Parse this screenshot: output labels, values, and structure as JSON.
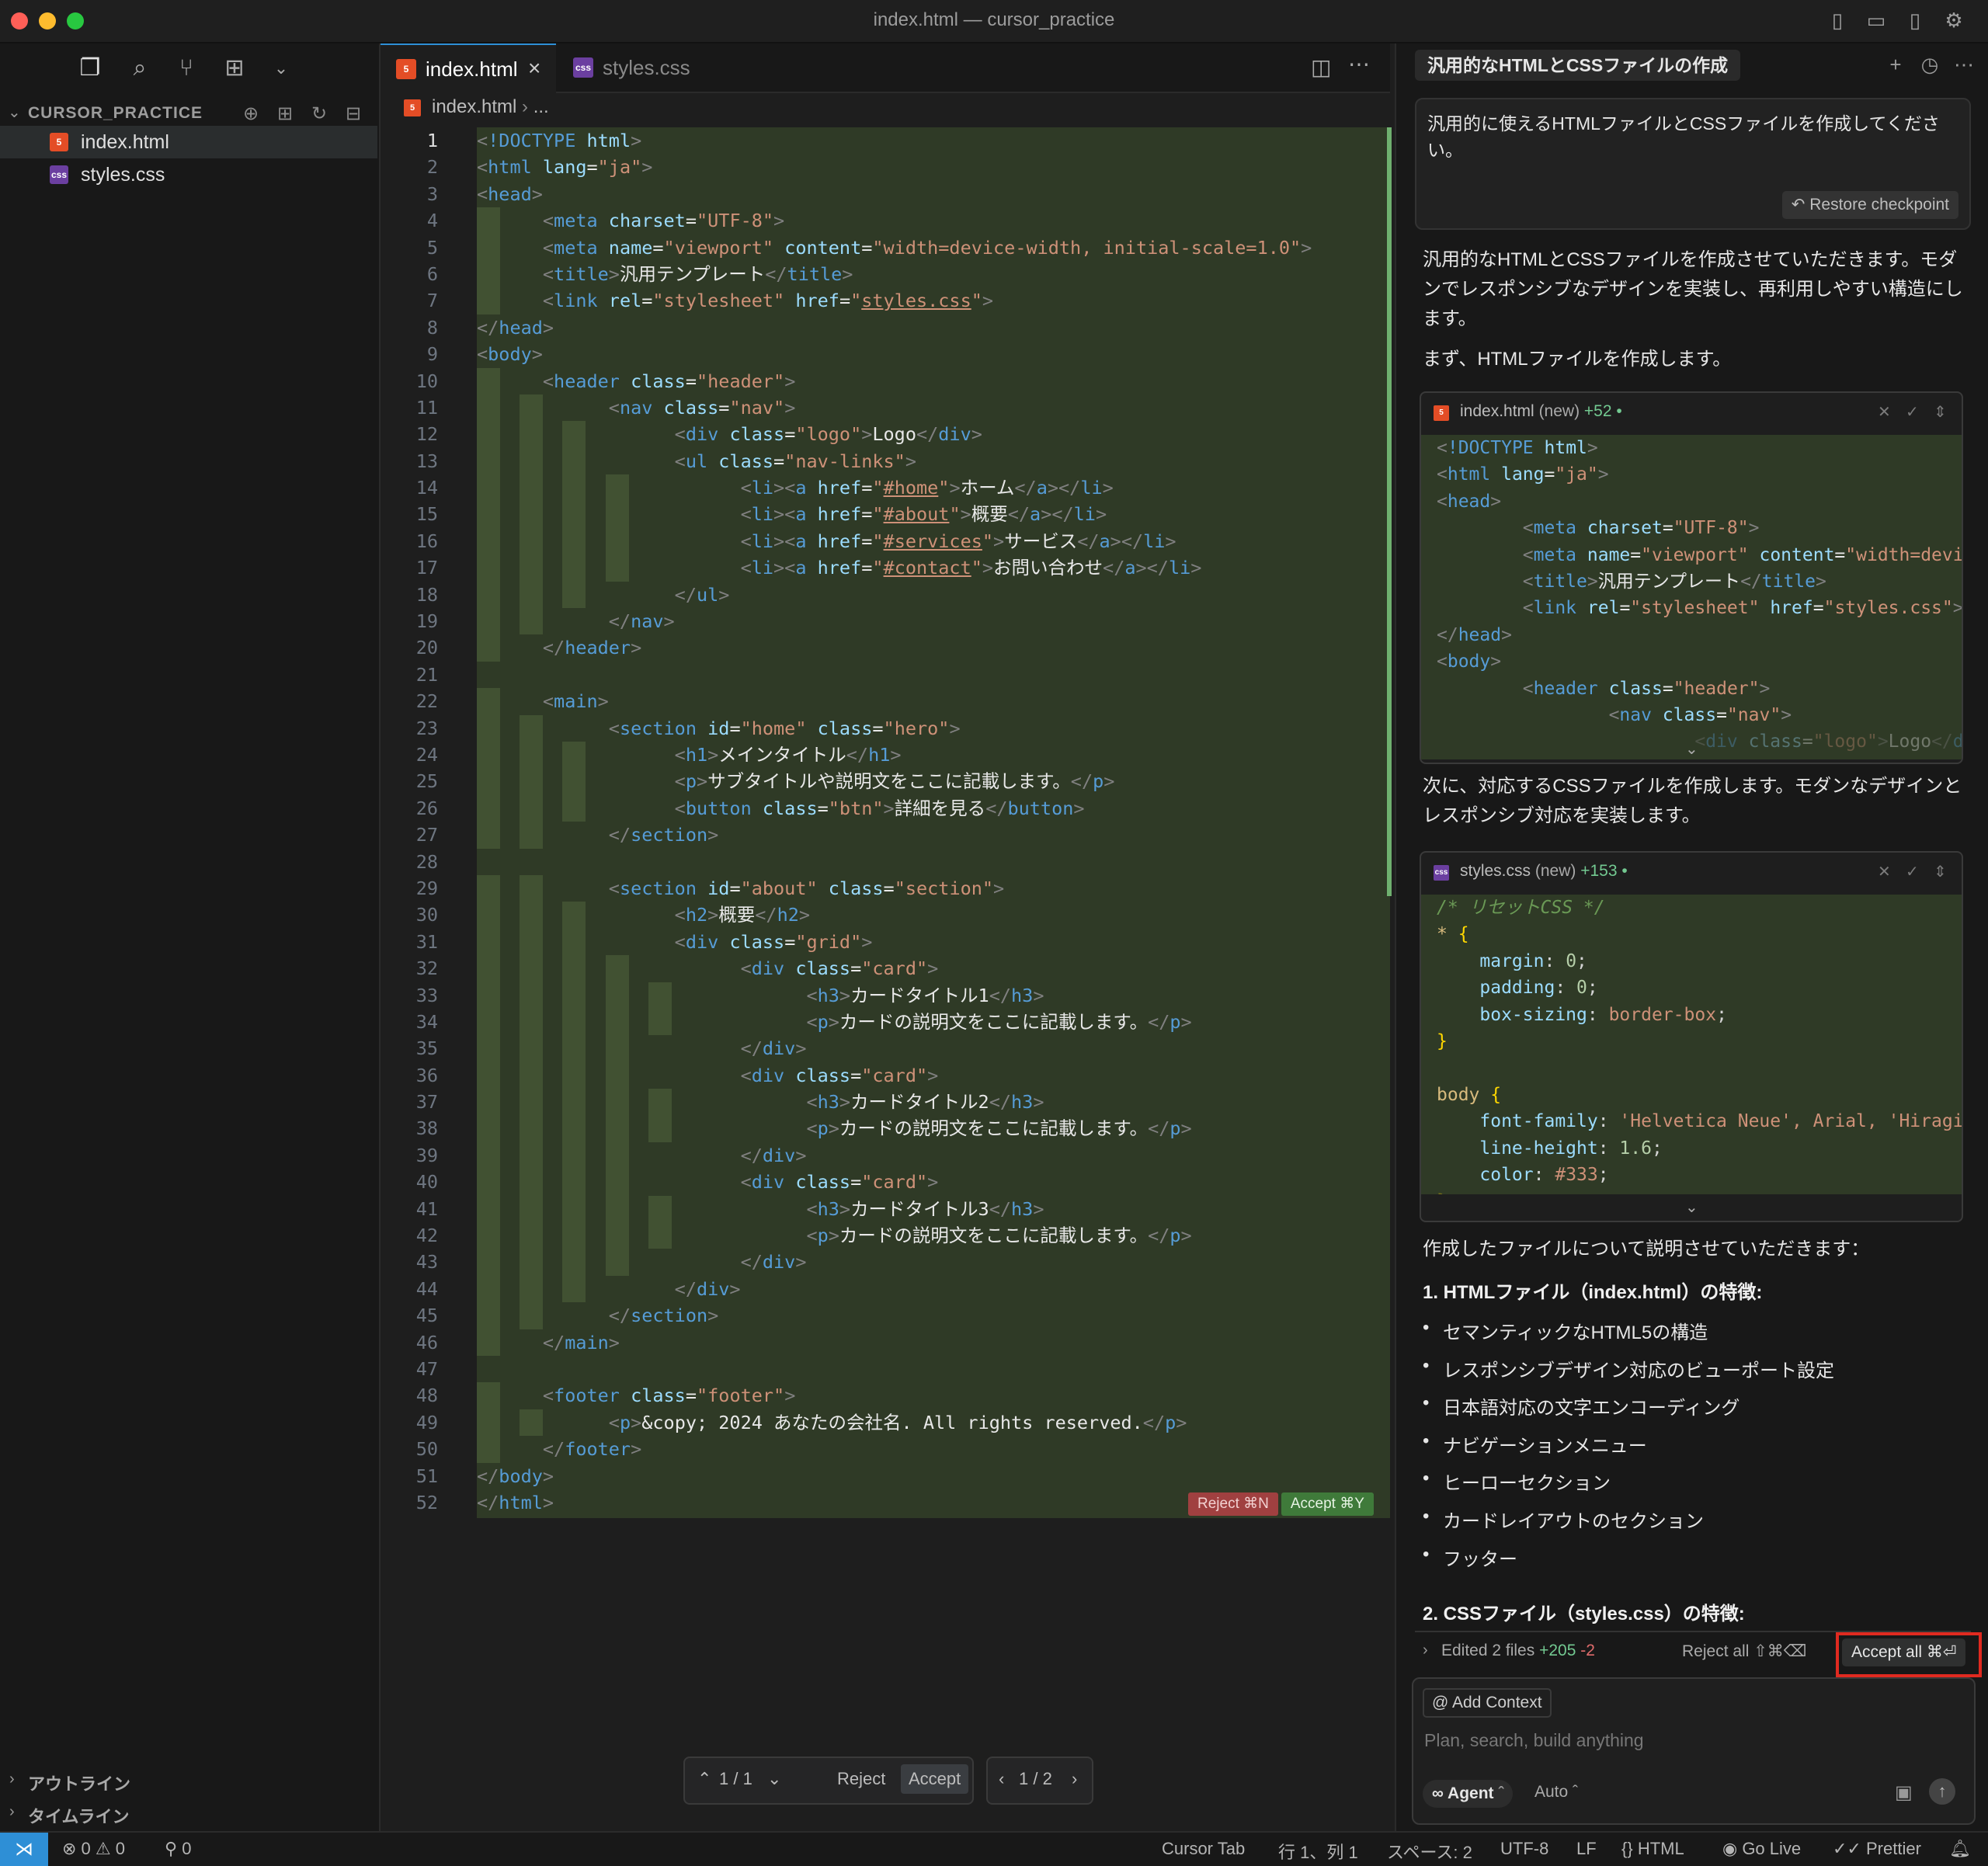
{
  "window": {
    "title": "index.html — cursor_practice"
  },
  "sidebar": {
    "explorer_title": "CURSOR_PRACTICE",
    "files": [
      {
        "name": "index.html",
        "icon": "html-file-icon",
        "active": true
      },
      {
        "name": "styles.css",
        "icon": "css-file-icon",
        "active": false
      }
    ],
    "bottom_sections": [
      "アウトライン",
      "タイムライン"
    ]
  },
  "editor": {
    "tabs": [
      {
        "label": "index.html",
        "active": true
      },
      {
        "label": "styles.css",
        "active": false
      }
    ],
    "breadcrumb": {
      "file": "index.html",
      "rest": "..."
    },
    "line_numbers": [
      "1",
      "2",
      "3",
      "4",
      "5",
      "6",
      "7",
      "8",
      "9",
      "10",
      "11",
      "12",
      "13",
      "14",
      "15",
      "16",
      "17",
      "18",
      "19",
      "20",
      "21",
      "22",
      "23",
      "24",
      "25",
      "26",
      "27",
      "28",
      "29",
      "30",
      "31",
      "32",
      "33",
      "34",
      "35",
      "36",
      "37",
      "38",
      "39",
      "40",
      "41",
      "42",
      "43",
      "44",
      "45",
      "46",
      "47",
      "48",
      "49",
      "50",
      "51",
      "52"
    ],
    "inline_reject": "Reject ⌘N",
    "inline_accept": "Accept ⌘Y",
    "diff_nav": {
      "count": "1 / 1",
      "reject": "Reject",
      "accept": "Accept",
      "file_count": "1 / 2"
    }
  },
  "panel": {
    "chat_title": "汎用的なHTMLとCSSファイルの作成",
    "user_message": "汎用的に使えるHTMLファイルとCSSファイルを作成してください。",
    "restore_checkpoint": "Restore checkpoint",
    "intro": "汎用的なHTMLとCSSファイルを作成させていただきます。モダンでレスポンシブなデザインを実装し、再利用しやすい構造にします。",
    "step1": "まず、HTMLファイルを作成します。",
    "html_card": {
      "file": "index.html",
      "status": "(new)",
      "added": "+52 •"
    },
    "step2": "次に、対応するCSSファイルを作成します。モダンなデザインとレスポンシブ対応を実装します。",
    "css_card": {
      "file": "styles.css",
      "status": "(new)",
      "added": "+153 •"
    },
    "explain": "作成したファイルについて説明させていただきます：",
    "html_features_heading": "1. HTMLファイル（index.html）の特徴:",
    "html_features": [
      "セマンティックなHTML5の構造",
      "レスポンシブデザイン対応のビューポート設定",
      "日本語対応の文字エンコーディング",
      "ナビゲーションメニュー",
      "ヒーローセクション",
      "カードレイアウトのセクション",
      "フッター"
    ],
    "css_features_heading": "2. CSSファイル（styles.css）の特徴:",
    "edited": {
      "label": "Edited 2 files",
      "added": "+205",
      "removed": "-2",
      "reject_all": "Reject all ⇧⌘⌫",
      "accept_all": "Accept all ⌘⏎"
    },
    "composer": {
      "add_context": "Add Context",
      "placeholder": "Plan, search, build anything",
      "agent": "Agent",
      "auto": "Auto"
    }
  },
  "statusbar": {
    "errors": "0",
    "warnings": "0",
    "ports": "0",
    "cursor_tab": "Cursor Tab",
    "position": "行 1、列 1",
    "spaces": "スペース: 2",
    "encoding": "UTF-8",
    "eol": "LF",
    "language": "HTML",
    "go_live": "Go Live",
    "prettier": "Prettier"
  },
  "colors": {
    "accent": "#2e8fd6",
    "diff_added_bg": "#2f3a26",
    "highlight_outline": "#e02a20"
  }
}
